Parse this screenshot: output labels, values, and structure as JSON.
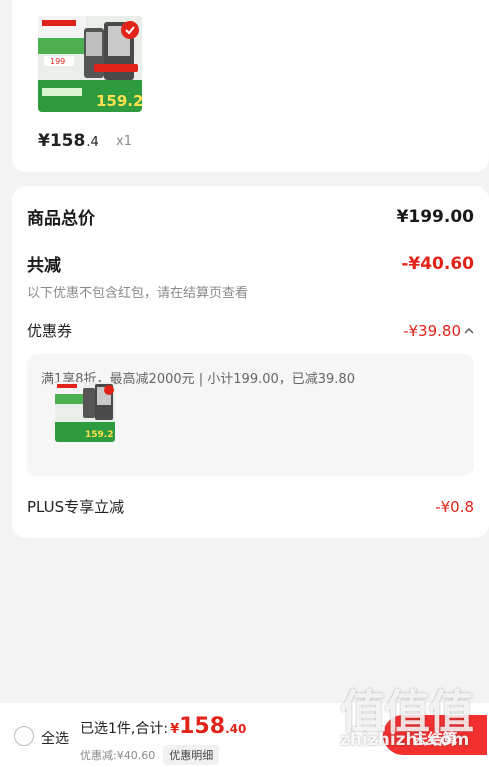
{
  "product": {
    "image_alt": "Joyoung blender product image",
    "price_int": "¥158",
    "price_dec": ".4",
    "quantity": "x1"
  },
  "summary": {
    "goods_total_label": "商品总价",
    "goods_total_value": "¥199.00",
    "total_discount_label": "共减",
    "total_discount_value": "-¥40.60",
    "discount_note": "以下优惠不包含红包，请在结算页查看",
    "coupon_label": "优惠券",
    "coupon_value": "-¥39.80",
    "coupon_detail": "满1享8折，最高减2000元 | 小计199.00，已减39.80",
    "plus_label": "PLUS专享立减",
    "plus_value": "-¥0.8"
  },
  "bottom_bar": {
    "select_all": "全选",
    "selected_info": "已选1件,合计:",
    "total_symbol": "¥",
    "total_int": "158",
    "total_dec": ".40",
    "discount_summary": "优惠减:¥40.60",
    "discount_detail_button": "优惠明细",
    "checkout_button": "去结算"
  },
  "watermark": {
    "chars": "值值值",
    "url": "zhizhizhi.com"
  },
  "colors": {
    "accent_red": "#e2231a",
    "checkout_red": "#f23030",
    "background": "#f3f3f3"
  }
}
